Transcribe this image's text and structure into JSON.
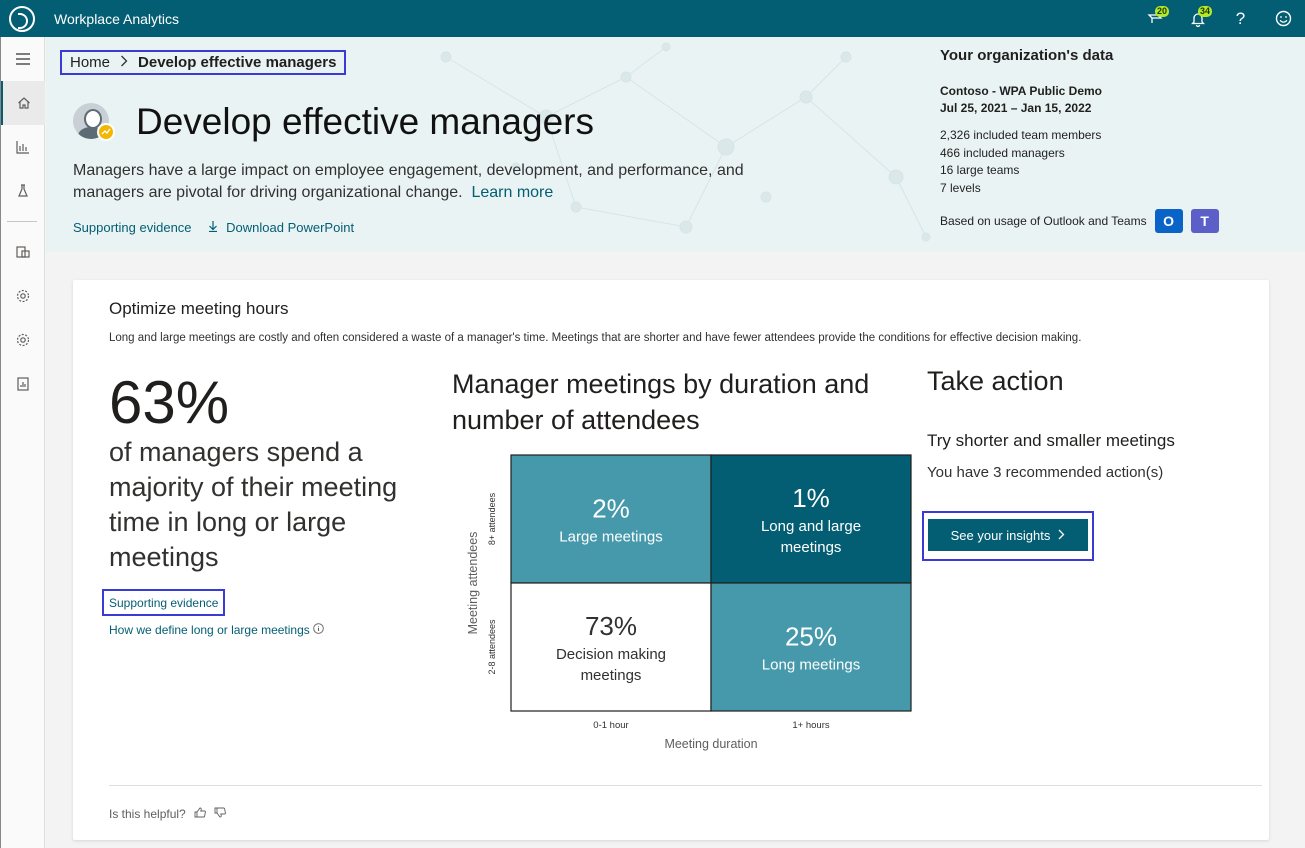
{
  "app": {
    "title": "Workplace Analytics"
  },
  "topbar": {
    "icons": [
      {
        "name": "feedback-icon",
        "badge": "20"
      },
      {
        "name": "notification-bell-icon",
        "badge": "34"
      },
      {
        "name": "help-icon",
        "label": "?"
      },
      {
        "name": "smiley-icon"
      }
    ]
  },
  "breadcrumb": {
    "home": "Home",
    "current": "Develop effective managers"
  },
  "hero": {
    "title": "Develop effective managers",
    "description": "Managers have a large impact on employee engagement, development, and performance, and managers are pivotal for driving organizational change.",
    "learn_more": "Learn more",
    "supporting_evidence": "Supporting evidence",
    "download": "Download PowerPoint"
  },
  "org": {
    "title": "Your organization's data",
    "name": "Contoso - WPA Public Demo",
    "dates": "Jul 25, 2021 – Jan 15, 2022",
    "stats": [
      "2,326 included team members",
      "466 included managers",
      "16 large teams",
      "7 levels"
    ],
    "usage": "Based on usage of Outlook and Teams"
  },
  "card": {
    "title": "Optimize meeting hours",
    "description": "Long and large meetings are costly and often considered a waste of a manager's time. Meetings that are shorter and have fewer attendees provide the conditions for effective decision making.",
    "stat": "63%",
    "stat_desc": "of managers spend a majority of their meeting time in long or large meetings",
    "supporting_evidence": "Supporting evidence",
    "define_link": "How we define long or large meetings",
    "chart_title": "Manager meetings by duration and number of attendees",
    "action_title": "Take action",
    "action_subtitle": "Try shorter and smaller meetings",
    "action_text": "You have 3 recommended action(s)",
    "insights_button": "See your insights",
    "helpful": "Is this helpful?"
  },
  "chart_data": {
    "type": "heatmap",
    "title": "Manager meetings by duration and number of attendees",
    "xlabel": "Meeting duration",
    "ylabel": "Meeting attendees",
    "x_categories": [
      "0-1 hour",
      "1+ hours"
    ],
    "y_categories": [
      "8+ attendees",
      "2-8 attendees"
    ],
    "cells": [
      {
        "x": "0-1 hour",
        "y": "8+ attendees",
        "value": 2,
        "display": "2%",
        "label": "Large meetings",
        "color": "#4699ab",
        "text_color": "#ffffff"
      },
      {
        "x": "1+ hours",
        "y": "8+ attendees",
        "value": 1,
        "display": "1%",
        "label": "Long and large meetings",
        "color": "#035e73",
        "text_color": "#ffffff"
      },
      {
        "x": "0-1 hour",
        "y": "2-8 attendees",
        "value": 73,
        "display": "73%",
        "label": "Decision making meetings",
        "color": "#ffffff",
        "text_color": "#323130"
      },
      {
        "x": "1+ hours",
        "y": "2-8 attendees",
        "value": 25,
        "display": "25%",
        "label": "Long meetings",
        "color": "#4699ab",
        "text_color": "#ffffff"
      }
    ]
  },
  "colors": {
    "brand": "#035e73",
    "accent_mid": "#4699ab",
    "link": "#035e73",
    "focus_outline": "#3a3ad6"
  }
}
